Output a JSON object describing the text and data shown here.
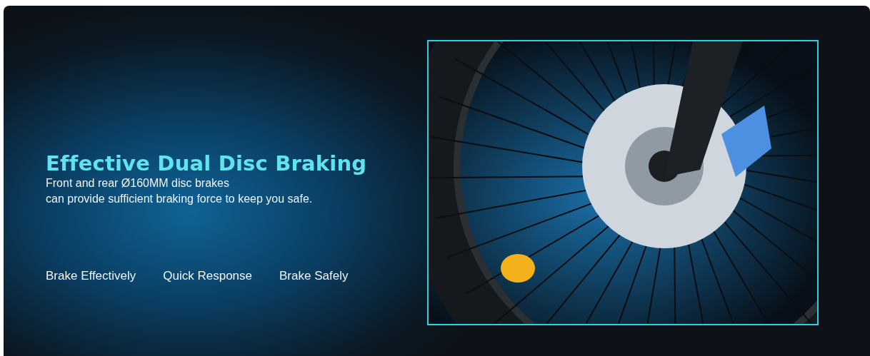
{
  "banner": {
    "title": "Effective Dual Disc Braking",
    "description_lines": [
      "Front and rear Ø160MM disc brakes",
      "can provide sufficient braking force to keep you safe."
    ],
    "features": [
      "Brake Effectively",
      "Quick Response",
      "Brake Safely"
    ],
    "photo": {
      "kind": "picture"
    }
  }
}
